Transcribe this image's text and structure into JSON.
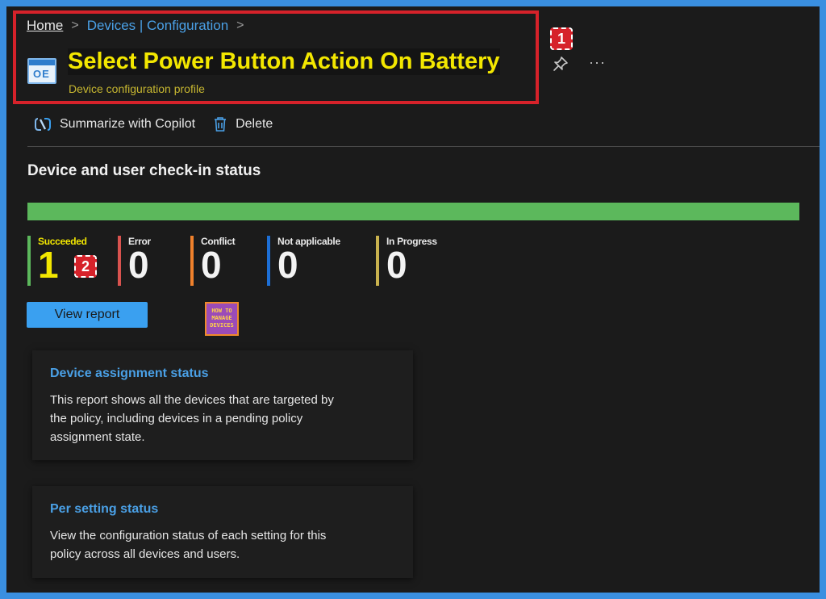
{
  "breadcrumb": {
    "home": "Home",
    "section": "Devices | Configuration",
    "sep1": ">",
    "sep2": ">"
  },
  "header": {
    "title": "Select Power Button Action On Battery",
    "subtitle": "Device configuration profile",
    "profile_icon_text": "OE",
    "more_label": "···",
    "badge1": "1",
    "badge2": "2"
  },
  "toolbar": {
    "copilot_label": "Summarize with Copilot",
    "delete_label": "Delete"
  },
  "status": {
    "title": "Device and user check-in status",
    "progress_fraction": 1.0,
    "stats": [
      {
        "label": "Succeeded",
        "count": "1",
        "color": "#5cb85c"
      },
      {
        "label": "Error",
        "count": "0",
        "color": "#d9534f"
      },
      {
        "label": "Conflict",
        "count": "0",
        "color": "#f0812c"
      },
      {
        "label": "Not applicable",
        "count": "0",
        "color": "#1d6fd6"
      },
      {
        "label": "In Progress",
        "count": "0",
        "color": "#c9b24e"
      }
    ],
    "view_report_label": "View report"
  },
  "logo": {
    "line1": "HOW TO",
    "line2": "MANAGE",
    "line3": "DEVICES"
  },
  "cards": [
    {
      "title": "Device assignment status",
      "description": "This report shows all the devices that are targeted by the policy, including devices in a pending policy assignment state."
    },
    {
      "title": "Per setting status",
      "description": "View the configuration status of each setting for this policy across all devices and users."
    }
  ],
  "colors": {
    "accent": "#4aa0e6",
    "highlight": "#f3e700",
    "annotation": "#d6222a",
    "success": "#5cb85c"
  }
}
